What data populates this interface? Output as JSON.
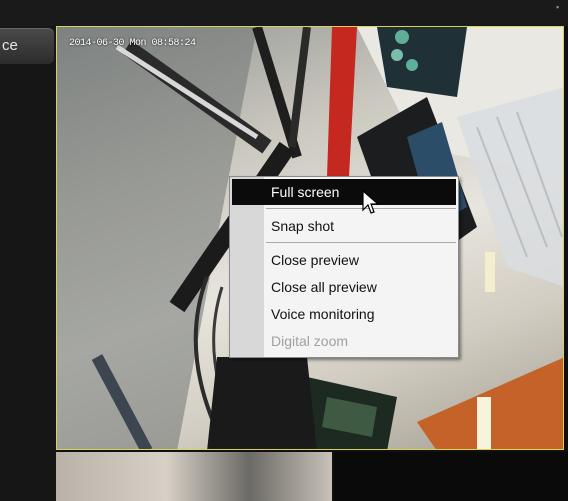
{
  "sidebar": {
    "tab_label": "ce"
  },
  "video": {
    "timestamp": "2014-06-30 Mon 08:58:24",
    "border_color": "#d8d25a"
  },
  "context_menu": {
    "items": [
      {
        "label": "Full screen",
        "state": "hovered"
      },
      {
        "label": "Snap shot",
        "state": "normal"
      },
      {
        "label": "Close preview",
        "state": "normal"
      },
      {
        "label": "Close all preview",
        "state": "normal"
      },
      {
        "label": "Voice monitoring",
        "state": "normal"
      },
      {
        "label": "Digital zoom",
        "state": "disabled"
      }
    ]
  },
  "icons": {
    "cursor": "arrow-cursor-icon"
  }
}
